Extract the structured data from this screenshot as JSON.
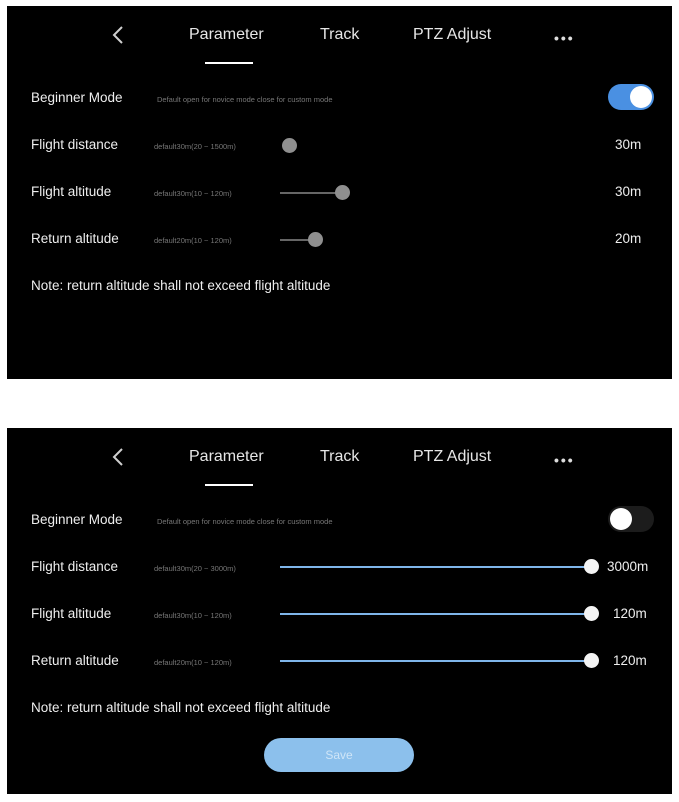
{
  "panels": [
    {
      "tabs": [
        "Parameter",
        "Track",
        "PTZ Adjust"
      ],
      "more_label": "•••",
      "beginner": {
        "label": "Beginner Mode",
        "hint": "Default open for novice mode close for custom mode",
        "enabled": true
      },
      "distance": {
        "label": "Flight distance",
        "hint": "default30m(20 ~ 1500m)",
        "value": "30m",
        "level": 0.007
      },
      "altitude": {
        "label": "Flight altitude",
        "hint": "default30m(10 ~ 120m)",
        "value": "30m",
        "level": 0.18
      },
      "return": {
        "label": "Return altitude",
        "hint": "default20m(10 ~ 120m)",
        "value": "20m",
        "level": 0.09
      },
      "note": "Note: return altitude shall not exceed flight altitude"
    },
    {
      "tabs": [
        "Parameter",
        "Track",
        "PTZ Adjust"
      ],
      "more_label": "•••",
      "beginner": {
        "label": "Beginner Mode",
        "hint": "Default open for novice mode close for custom mode",
        "enabled": false
      },
      "distance": {
        "label": "Flight distance",
        "hint": "default30m(20 ~ 3000m)",
        "value": "3000m",
        "level": 1.0
      },
      "altitude": {
        "label": "Flight altitude",
        "hint": "default30m(10 ~ 120m)",
        "value": "120m",
        "level": 1.0
      },
      "return": {
        "label": "Return altitude",
        "hint": "default20m(10 ~ 120m)",
        "value": "120m",
        "level": 1.0
      },
      "note": "Note: return altitude shall not exceed flight altitude",
      "save_label": "Save"
    }
  ],
  "colors": {
    "accent": "#4a90e2",
    "slider_fill": "#7fb5ea",
    "save_button": "#8cc0ec"
  }
}
